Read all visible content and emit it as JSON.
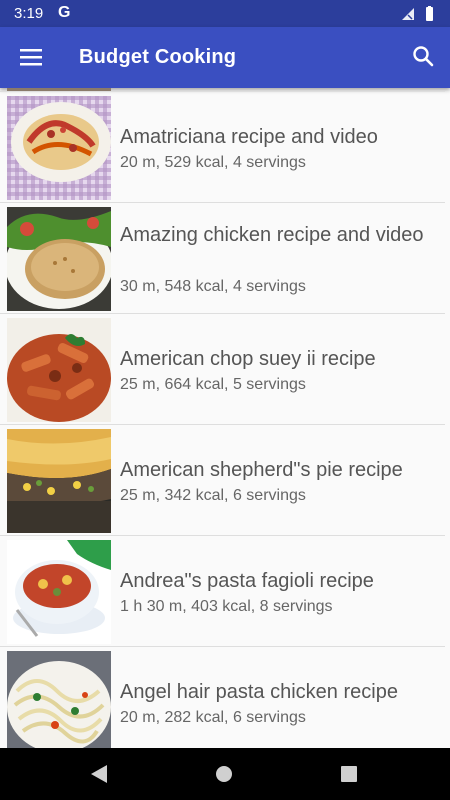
{
  "status_bar": {
    "time": "3:19",
    "app_icon_letter": "G",
    "icons": [
      "signal-off-icon",
      "battery-icon"
    ]
  },
  "app_bar": {
    "menu_icon": "menu-icon",
    "title": "Budget Cooking",
    "search_icon": "search-icon"
  },
  "recipes": [
    {
      "title": "Amatriciana recipe and video",
      "details": "20 m, 529 kcal, 4 servings"
    },
    {
      "title": "Amazing chicken recipe and video",
      "details": "30 m, 548 kcal, 4 servings"
    },
    {
      "title": "American chop suey ii recipe",
      "details": "25 m, 664 kcal, 5 servings"
    },
    {
      "title": "American shepherd\"s pie recipe",
      "details": "25 m, 342 kcal, 6 servings"
    },
    {
      "title": "Andrea\"s pasta fagioli recipe",
      "details": "1 h 30 m, 403 kcal, 8 servings"
    },
    {
      "title": "Angel hair pasta chicken recipe",
      "details": "20 m, 282 kcal, 6 servings"
    }
  ],
  "nav_bar": {
    "icons": [
      "back-icon",
      "home-icon",
      "recents-icon"
    ]
  },
  "colors": {
    "status_bar": "#2c3e9c",
    "app_bar": "#3a4fc1",
    "title_text": "#555555",
    "detail_text": "#666666"
  }
}
